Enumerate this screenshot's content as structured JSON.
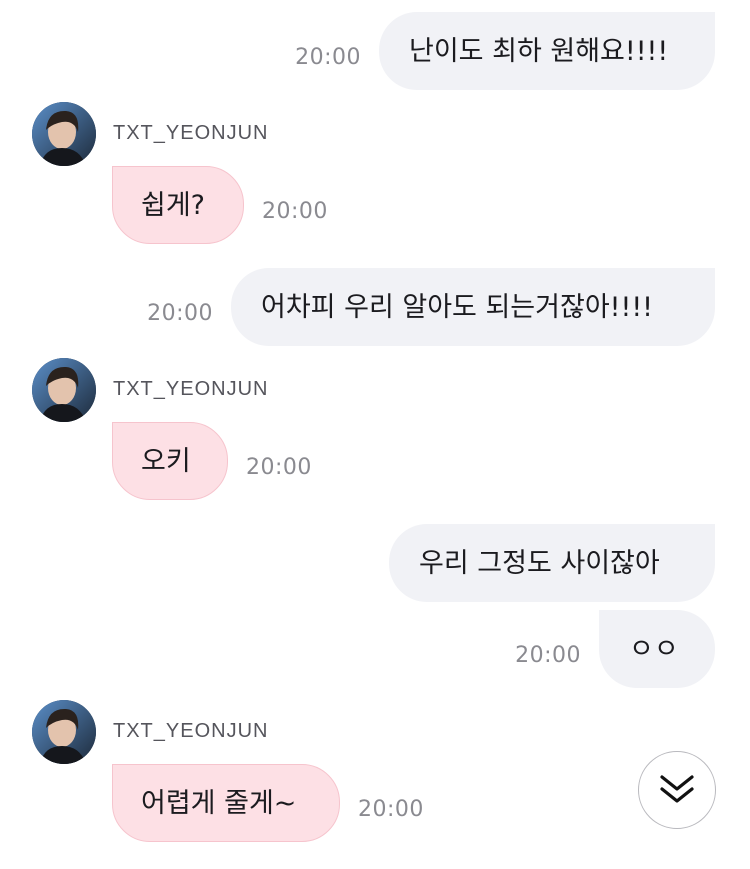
{
  "sender_name": "TXT_YEONJUN",
  "messages": [
    {
      "text": "난이도 최하 원해요!!!!",
      "time": "20:00"
    },
    {
      "text": "쉽게?",
      "time": "20:00"
    },
    {
      "text": "어차피 우리 알아도 되는거잖아!!!!",
      "time": "20:00"
    },
    {
      "text": "오키",
      "time": "20:00"
    },
    {
      "text": "우리 그정도 사이잖아"
    },
    {
      "text": "ㅇㅇ",
      "time": "20:00"
    },
    {
      "text": "어렵게 줄게~",
      "time": "20:00"
    }
  ],
  "icons": {
    "avatar": "profile-photo",
    "scroll_down": "double-chevron-down-icon"
  },
  "colors": {
    "my_bubble": "#f1f2f6",
    "their_bubble": "#fde0e5",
    "their_bubble_border": "#f6c4cd",
    "timestamp": "#8a8a90"
  }
}
